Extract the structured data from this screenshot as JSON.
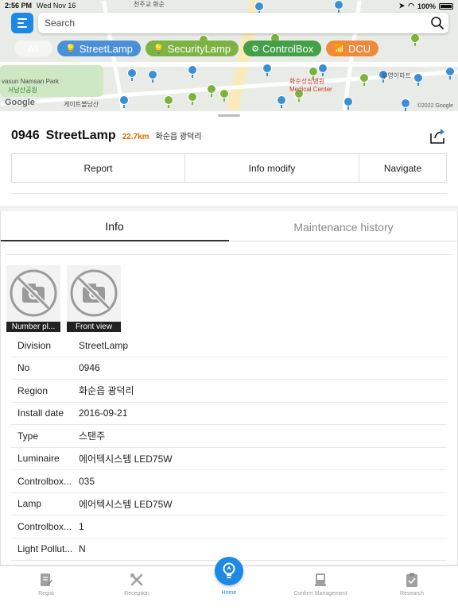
{
  "status_bar": {
    "time": "2:56 PM",
    "date": "Wed Nov 16",
    "battery": "100%"
  },
  "search": {
    "placeholder": "Search"
  },
  "filters": [
    {
      "label": "All",
      "color": "#ffffff"
    },
    {
      "label": "StreetLamp",
      "color": "#4a90d9"
    },
    {
      "label": "SecurityLamp",
      "color": "#7cb342"
    },
    {
      "label": "ControlBox",
      "color": "#43a047"
    },
    {
      "label": "DCU",
      "color": "#ef8a3c"
    }
  ],
  "map": {
    "labels": {
      "park": "vasun Namsan Park",
      "park_ko": "서남산공원",
      "hospital": "화순성심병원",
      "hospital_en": "Medical Center",
      "church": "천주교 화순",
      "gate": "게이트볼남산",
      "apartment": "부영아파트",
      "google": "Google",
      "copyright": "©2022 Google"
    }
  },
  "asset": {
    "number": "0946",
    "type": "StreetLamp",
    "distance": "22.7km",
    "address": "화순읍 광덕리"
  },
  "actions": {
    "report": "Report",
    "info_modify": "Info modify",
    "navigate": "Navigate"
  },
  "tabs": {
    "info": "Info",
    "maintenance": "Maintenance history"
  },
  "photos": [
    {
      "caption": "Number pl..."
    },
    {
      "caption": "Front view"
    }
  ],
  "info_rows": [
    {
      "key": "Division",
      "value": "StreetLamp"
    },
    {
      "key": "No",
      "value": "0946"
    },
    {
      "key": "Region",
      "value": "화순읍 광덕리"
    },
    {
      "key": "Install date",
      "value": "2016-09-21"
    },
    {
      "key": "Type",
      "value": "스탠주"
    },
    {
      "key": "Luminaire",
      "value": "에어텍시스템 LED75W"
    },
    {
      "key": "Controlbox...",
      "value": "035"
    },
    {
      "key": "Lamp",
      "value": "에어텍시스템 LED75W"
    },
    {
      "key": "Controlbox...",
      "value": "1"
    },
    {
      "key": "Light Pollut...",
      "value": "N"
    }
  ],
  "tabbar": {
    "regist": "Regist",
    "reception": "Reception",
    "home": "Home",
    "confirm": "Confirm Management",
    "research": "Research"
  },
  "colors": {
    "accent": "#1e88e5",
    "distance": "#e26a00"
  }
}
